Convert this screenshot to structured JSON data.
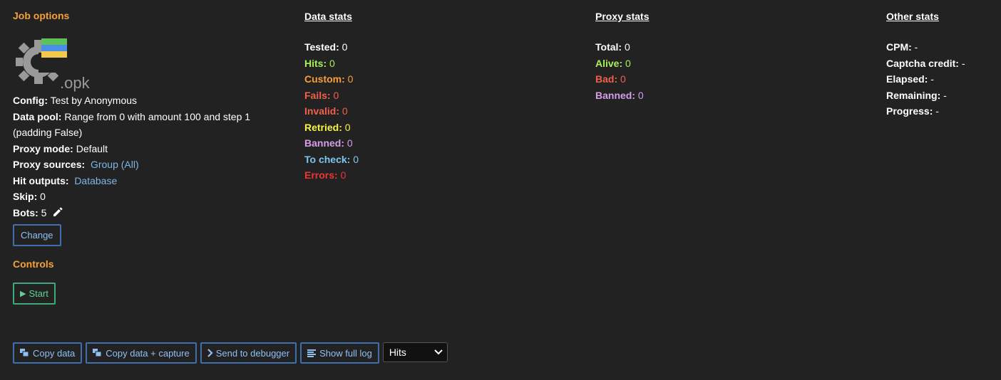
{
  "job": {
    "title": "Job options",
    "logo_text": ".opk",
    "config_label": "Config:",
    "config_value": "Test by Anonymous",
    "datapool_label": "Data pool:",
    "datapool_value": "Range from 0 with amount 100 and step 1 (padding False)",
    "proxymode_label": "Proxy mode:",
    "proxymode_value": "Default",
    "proxysources_label": "Proxy sources:",
    "proxysources_value": "Group (All)",
    "hitoutputs_label": "Hit outputs:",
    "hitoutputs_value": "Database",
    "skip_label": "Skip:",
    "skip_value": "0",
    "bots_label": "Bots:",
    "bots_value": "5",
    "change_label": "Change"
  },
  "controls": {
    "title": "Controls",
    "start_label": "Start"
  },
  "data_stats": {
    "title": "Data stats",
    "items": [
      {
        "label": "Tested:",
        "value": "0",
        "color": "#ffffff"
      },
      {
        "label": "Hits:",
        "value": "0",
        "color": "#a7f05a"
      },
      {
        "label": "Custom:",
        "value": "0",
        "color": "#f6a03a"
      },
      {
        "label": "Fails:",
        "value": "0",
        "color": "#f0604a"
      },
      {
        "label": "Invalid:",
        "value": "0",
        "color": "#f0604a"
      },
      {
        "label": "Retried:",
        "value": "0",
        "color": "#f5f545"
      },
      {
        "label": "Banned:",
        "value": "0",
        "color": "#d79ee8"
      },
      {
        "label": "To check:",
        "value": "0",
        "color": "#7fc6ec"
      },
      {
        "label": "Errors:",
        "value": "0",
        "color": "#ee3535"
      }
    ]
  },
  "proxy_stats": {
    "title": "Proxy stats",
    "items": [
      {
        "label": "Total:",
        "value": "0",
        "color": "#ffffff"
      },
      {
        "label": "Alive:",
        "value": "0",
        "color": "#a7f05a"
      },
      {
        "label": "Bad:",
        "value": "0",
        "color": "#f0604a"
      },
      {
        "label": "Banned:",
        "value": "0",
        "color": "#d79ee8"
      }
    ]
  },
  "other_stats": {
    "title": "Other stats",
    "items": [
      {
        "label": "CPM:",
        "value": "-"
      },
      {
        "label": "Captcha credit:",
        "value": "-"
      },
      {
        "label": "Elapsed:",
        "value": "-"
      },
      {
        "label": "Remaining:",
        "value": "-"
      },
      {
        "label": "Progress:",
        "value": "-"
      }
    ]
  },
  "toolbar": {
    "copy_data": "Copy data",
    "copy_data_capture": "Copy data + capture",
    "send_debugger": "Send to debugger",
    "show_log": "Show full log",
    "filter_selected": "Hits"
  }
}
